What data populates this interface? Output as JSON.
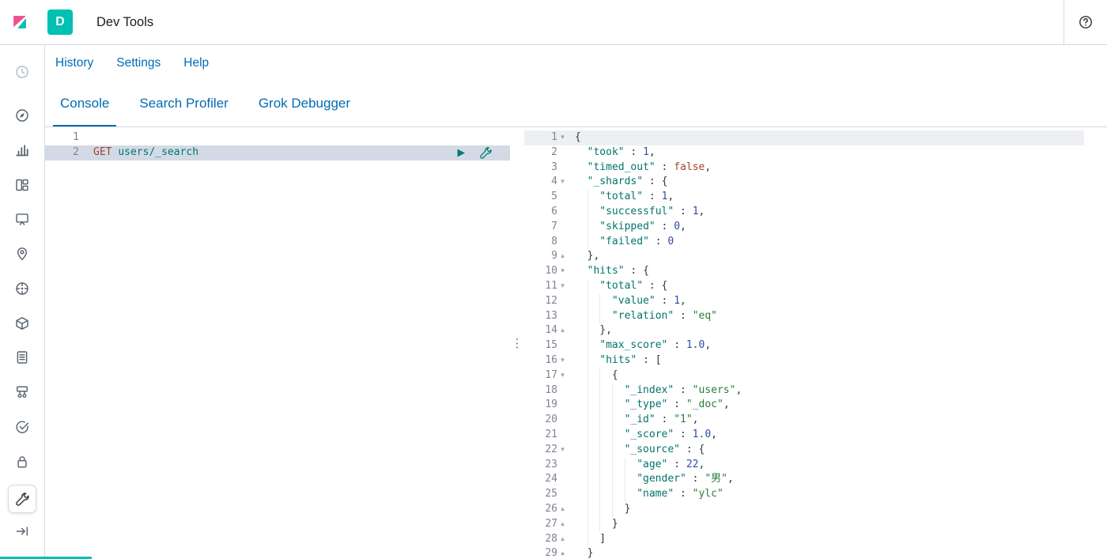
{
  "header": {
    "title": "Dev Tools",
    "space_badge": "D"
  },
  "nav_links": [
    {
      "label": "History"
    },
    {
      "label": "Settings"
    },
    {
      "label": "Help"
    }
  ],
  "tabs": [
    {
      "label": "Console",
      "active": true
    },
    {
      "label": "Search Profiler",
      "active": false
    },
    {
      "label": "Grok Debugger",
      "active": false
    }
  ],
  "sidebar": {
    "items": [
      {
        "name": "recently-viewed",
        "dim": true
      },
      {
        "name": "discover"
      },
      {
        "name": "visualize"
      },
      {
        "name": "dashboard"
      },
      {
        "name": "canvas"
      },
      {
        "name": "maps"
      },
      {
        "name": "machine-learning"
      },
      {
        "name": "infrastructure"
      },
      {
        "name": "logs"
      },
      {
        "name": "apm"
      },
      {
        "name": "uptime"
      },
      {
        "name": "siem"
      }
    ],
    "bottom": [
      {
        "name": "dev-tools",
        "active": true
      },
      {
        "name": "expand-nav"
      }
    ]
  },
  "request_editor": {
    "lines": [
      {
        "num": "1",
        "indent": 0,
        "tokens": []
      },
      {
        "num": "2",
        "indent": 0,
        "selected": true,
        "tokens": [
          {
            "t": "method",
            "v": "GET"
          },
          {
            "t": "text",
            "v": " "
          },
          {
            "t": "url",
            "v": "users/_search"
          }
        ]
      }
    ],
    "actions": [
      {
        "name": "send-request",
        "icon": "play"
      },
      {
        "name": "request-options",
        "icon": "wrench"
      }
    ]
  },
  "response_editor": {
    "lines": [
      {
        "num": "1",
        "indent": 0,
        "fold": "open",
        "active": true,
        "tokens": [
          {
            "t": "punct",
            "v": "{"
          }
        ]
      },
      {
        "num": "2",
        "indent": 1,
        "tokens": [
          {
            "t": "key",
            "v": "\"took\""
          },
          {
            "t": "punct",
            "v": " : "
          },
          {
            "t": "num",
            "v": "1"
          },
          {
            "t": "punct",
            "v": ","
          }
        ]
      },
      {
        "num": "3",
        "indent": 1,
        "tokens": [
          {
            "t": "key",
            "v": "\"timed_out\""
          },
          {
            "t": "punct",
            "v": " : "
          },
          {
            "t": "bool",
            "v": "false"
          },
          {
            "t": "punct",
            "v": ","
          }
        ]
      },
      {
        "num": "4",
        "indent": 1,
        "fold": "open",
        "tokens": [
          {
            "t": "key",
            "v": "\"_shards\""
          },
          {
            "t": "punct",
            "v": " : {"
          }
        ]
      },
      {
        "num": "5",
        "indent": 2,
        "tokens": [
          {
            "t": "key",
            "v": "\"total\""
          },
          {
            "t": "punct",
            "v": " : "
          },
          {
            "t": "num",
            "v": "1"
          },
          {
            "t": "punct",
            "v": ","
          }
        ]
      },
      {
        "num": "6",
        "indent": 2,
        "tokens": [
          {
            "t": "key",
            "v": "\"successful\""
          },
          {
            "t": "punct",
            "v": " : "
          },
          {
            "t": "num",
            "v": "1"
          },
          {
            "t": "punct",
            "v": ","
          }
        ]
      },
      {
        "num": "7",
        "indent": 2,
        "tokens": [
          {
            "t": "key",
            "v": "\"skipped\""
          },
          {
            "t": "punct",
            "v": " : "
          },
          {
            "t": "num",
            "v": "0"
          },
          {
            "t": "punct",
            "v": ","
          }
        ]
      },
      {
        "num": "8",
        "indent": 2,
        "tokens": [
          {
            "t": "key",
            "v": "\"failed\""
          },
          {
            "t": "punct",
            "v": " : "
          },
          {
            "t": "num",
            "v": "0"
          }
        ]
      },
      {
        "num": "9",
        "indent": 1,
        "fold": "close",
        "tokens": [
          {
            "t": "punct",
            "v": "},"
          }
        ]
      },
      {
        "num": "10",
        "indent": 1,
        "fold": "open",
        "tokens": [
          {
            "t": "key",
            "v": "\"hits\""
          },
          {
            "t": "punct",
            "v": " : {"
          }
        ]
      },
      {
        "num": "11",
        "indent": 2,
        "fold": "open",
        "tokens": [
          {
            "t": "key",
            "v": "\"total\""
          },
          {
            "t": "punct",
            "v": " : {"
          }
        ]
      },
      {
        "num": "12",
        "indent": 3,
        "tokens": [
          {
            "t": "key",
            "v": "\"value\""
          },
          {
            "t": "punct",
            "v": " : "
          },
          {
            "t": "num",
            "v": "1"
          },
          {
            "t": "punct",
            "v": ","
          }
        ]
      },
      {
        "num": "13",
        "indent": 3,
        "tokens": [
          {
            "t": "key",
            "v": "\"relation\""
          },
          {
            "t": "punct",
            "v": " : "
          },
          {
            "t": "str",
            "v": "\"eq\""
          }
        ]
      },
      {
        "num": "14",
        "indent": 2,
        "fold": "close",
        "tokens": [
          {
            "t": "punct",
            "v": "},"
          }
        ]
      },
      {
        "num": "15",
        "indent": 2,
        "tokens": [
          {
            "t": "key",
            "v": "\"max_score\""
          },
          {
            "t": "punct",
            "v": " : "
          },
          {
            "t": "num",
            "v": "1.0"
          },
          {
            "t": "punct",
            "v": ","
          }
        ]
      },
      {
        "num": "16",
        "indent": 2,
        "fold": "open",
        "tokens": [
          {
            "t": "key",
            "v": "\"hits\""
          },
          {
            "t": "punct",
            "v": " : ["
          }
        ]
      },
      {
        "num": "17",
        "indent": 3,
        "fold": "open",
        "tokens": [
          {
            "t": "punct",
            "v": "{"
          }
        ]
      },
      {
        "num": "18",
        "indent": 4,
        "tokens": [
          {
            "t": "key",
            "v": "\"_index\""
          },
          {
            "t": "punct",
            "v": " : "
          },
          {
            "t": "str",
            "v": "\"users\""
          },
          {
            "t": "punct",
            "v": ","
          }
        ]
      },
      {
        "num": "19",
        "indent": 4,
        "tokens": [
          {
            "t": "key",
            "v": "\"_type\""
          },
          {
            "t": "punct",
            "v": " : "
          },
          {
            "t": "str",
            "v": "\"_doc\""
          },
          {
            "t": "punct",
            "v": ","
          }
        ]
      },
      {
        "num": "20",
        "indent": 4,
        "tokens": [
          {
            "t": "key",
            "v": "\"_id\""
          },
          {
            "t": "punct",
            "v": " : "
          },
          {
            "t": "str",
            "v": "\"1\""
          },
          {
            "t": "punct",
            "v": ","
          }
        ]
      },
      {
        "num": "21",
        "indent": 4,
        "tokens": [
          {
            "t": "key",
            "v": "\"_score\""
          },
          {
            "t": "punct",
            "v": " : "
          },
          {
            "t": "num",
            "v": "1.0"
          },
          {
            "t": "punct",
            "v": ","
          }
        ]
      },
      {
        "num": "22",
        "indent": 4,
        "fold": "open",
        "tokens": [
          {
            "t": "key",
            "v": "\"_source\""
          },
          {
            "t": "punct",
            "v": " : {"
          }
        ]
      },
      {
        "num": "23",
        "indent": 5,
        "tokens": [
          {
            "t": "key",
            "v": "\"age\""
          },
          {
            "t": "punct",
            "v": " : "
          },
          {
            "t": "num",
            "v": "22"
          },
          {
            "t": "punct",
            "v": ","
          }
        ]
      },
      {
        "num": "24",
        "indent": 5,
        "tokens": [
          {
            "t": "key",
            "v": "\"gender\""
          },
          {
            "t": "punct",
            "v": " : "
          },
          {
            "t": "str",
            "v": "\"男\""
          },
          {
            "t": "punct",
            "v": ","
          }
        ]
      },
      {
        "num": "25",
        "indent": 5,
        "tokens": [
          {
            "t": "key",
            "v": "\"name\""
          },
          {
            "t": "punct",
            "v": " : "
          },
          {
            "t": "str",
            "v": "\"ylc\""
          }
        ]
      },
      {
        "num": "26",
        "indent": 4,
        "fold": "close",
        "tokens": [
          {
            "t": "punct",
            "v": "}"
          }
        ]
      },
      {
        "num": "27",
        "indent": 3,
        "fold": "close",
        "tokens": [
          {
            "t": "punct",
            "v": "}"
          }
        ]
      },
      {
        "num": "28",
        "indent": 2,
        "fold": "close",
        "tokens": [
          {
            "t": "punct",
            "v": "]"
          }
        ]
      },
      {
        "num": "29",
        "indent": 1,
        "fold": "close",
        "tokens": [
          {
            "t": "punct",
            "v": "}"
          }
        ]
      }
    ]
  },
  "icons": {
    "resizer_glyph": "⋮",
    "fold_open": "▾",
    "fold_close": "▴"
  },
  "colors": {
    "accent_teal": "#00BFB3",
    "link_blue": "#006BB4",
    "border": "#D3DAE6",
    "selected_line_bg": "#D3DAE6",
    "active_line_bg": "#EDEFF2",
    "key": "#00756C",
    "string": "#2B7D3B",
    "number": "#2F4DA0",
    "boolean": "#A0432A",
    "method": "#A0432A",
    "url": "#00756C",
    "text": "#343741",
    "gutter_text": "#7D8492",
    "icon_gray": "#5A6470",
    "action_teal": "#017D73"
  }
}
